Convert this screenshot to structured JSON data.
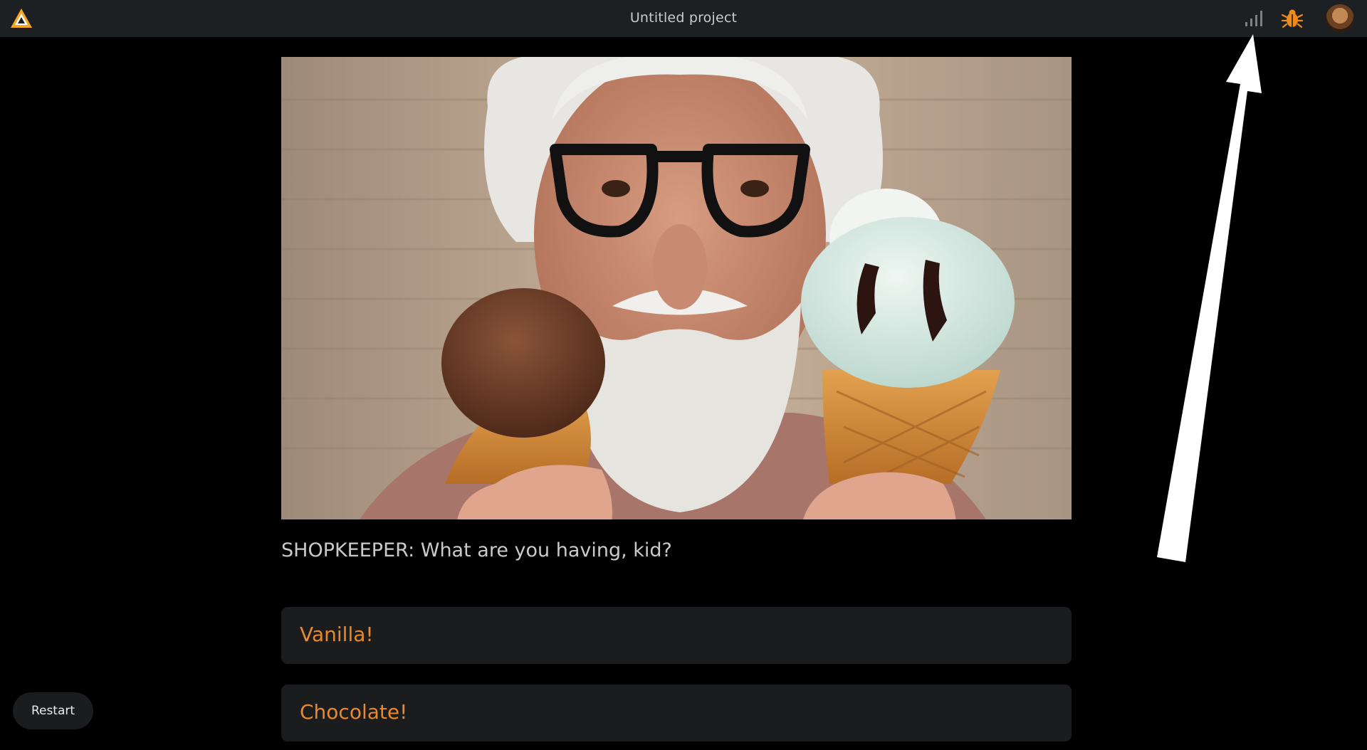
{
  "header": {
    "title": "Untitled project"
  },
  "icons": {
    "logo": "app-logo",
    "stats": "stats-bars-icon",
    "debug": "bug-icon",
    "avatar": "user-avatar"
  },
  "scene": {
    "image": "shopkeeper-holding-ice-cream-cones"
  },
  "dialogue": {
    "text": "SHOPKEEPER: What are you having, kid?"
  },
  "choices": [
    {
      "label": "Vanilla!"
    },
    {
      "label": "Chocolate!"
    }
  ],
  "controls": {
    "restart_label": "Restart"
  },
  "colors": {
    "accent": "#e8892d",
    "topbar": "#1d2022",
    "panel": "#1a1c1d",
    "background": "#000000"
  }
}
